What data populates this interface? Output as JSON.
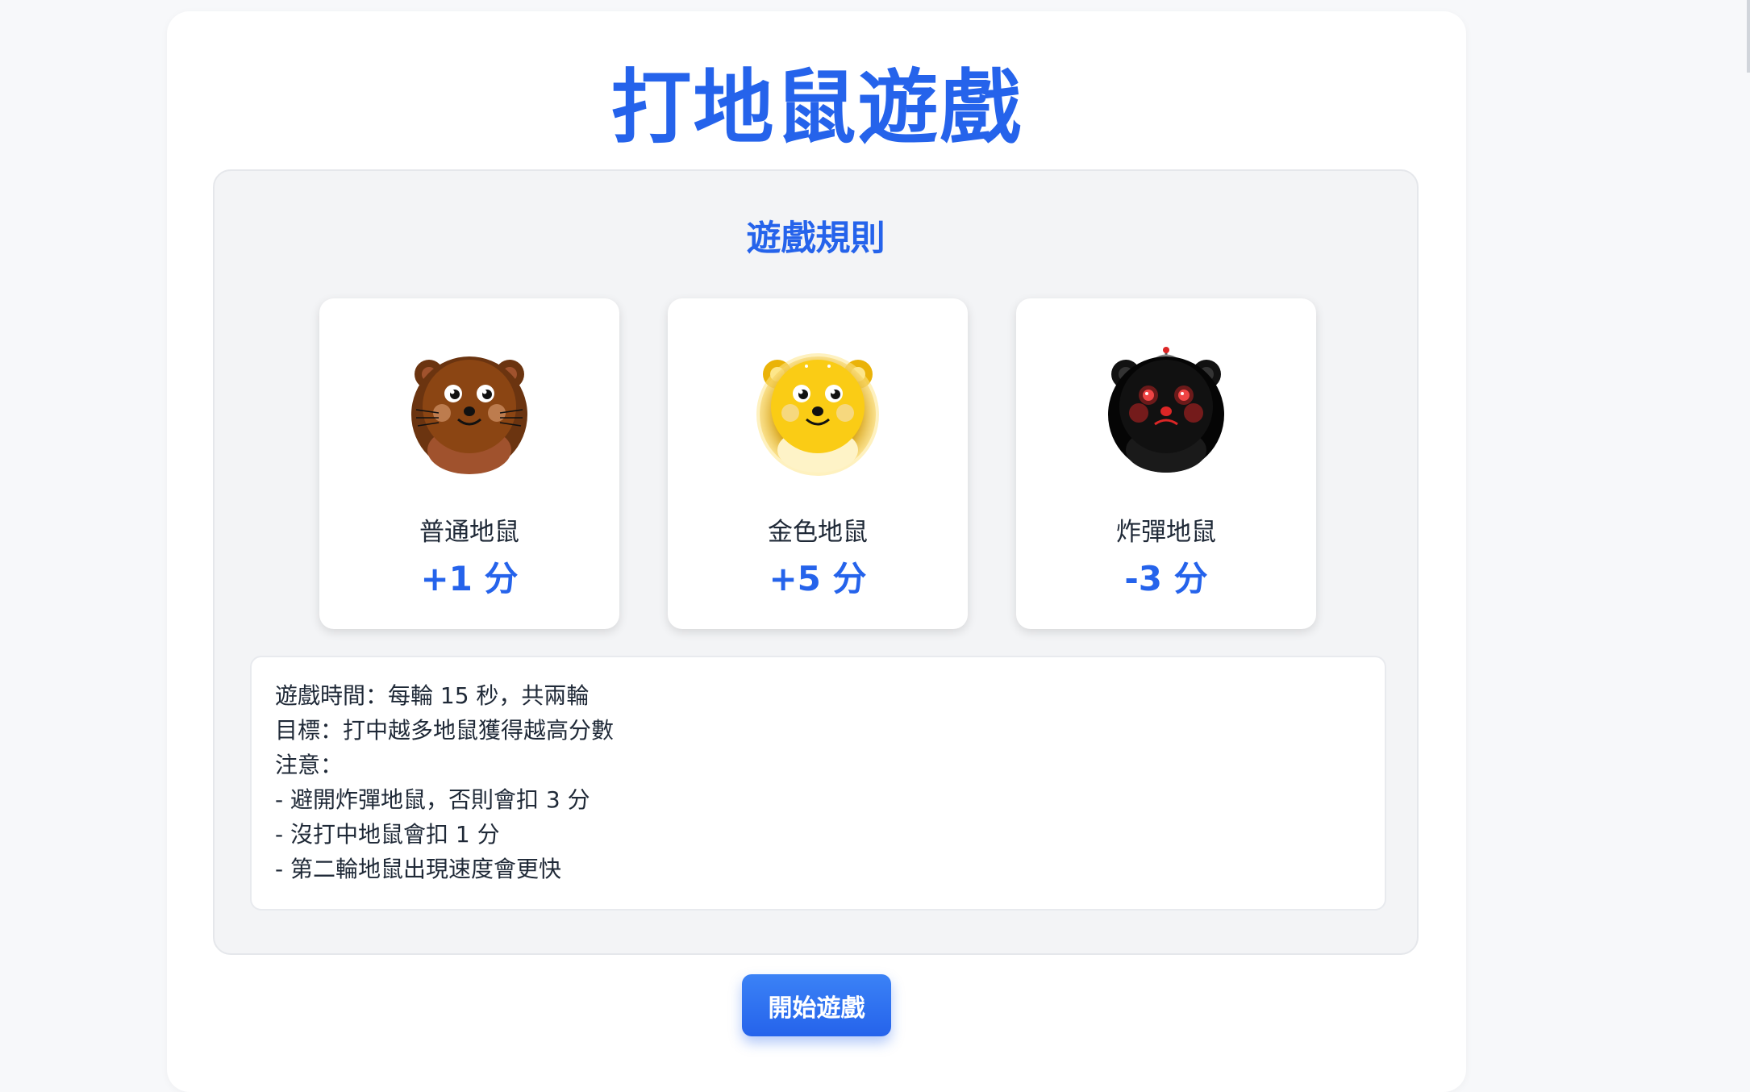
{
  "title": "打地鼠遊戲",
  "rules": {
    "heading": "遊戲規則",
    "moles": [
      {
        "name": "普通地鼠",
        "score": "+1 分",
        "icon": "brown-mole-icon"
      },
      {
        "name": "金色地鼠",
        "score": "+5 分",
        "icon": "golden-mole-icon"
      },
      {
        "name": "炸彈地鼠",
        "score": "-3 分",
        "icon": "bomb-mole-icon"
      }
    ],
    "info_lines": [
      "遊戲時間：每輪 15 秒，共兩輪",
      "目標：打中越多地鼠獲得越高分數",
      "注意：",
      "- 避開炸彈地鼠，否則會扣 3 分",
      "- 沒打中地鼠會扣 1 分",
      "- 第二輪地鼠出現速度會更快"
    ]
  },
  "start_button": "開始遊戲",
  "colors": {
    "accent": "#2563eb",
    "panel_bg": "#f3f4f6",
    "page_bg": "#f7f8fa",
    "mole_brown": "#8b4513",
    "mole_gold": "#facc15",
    "mole_bomb": "#111111",
    "bomb_eye": "#dc2626"
  }
}
